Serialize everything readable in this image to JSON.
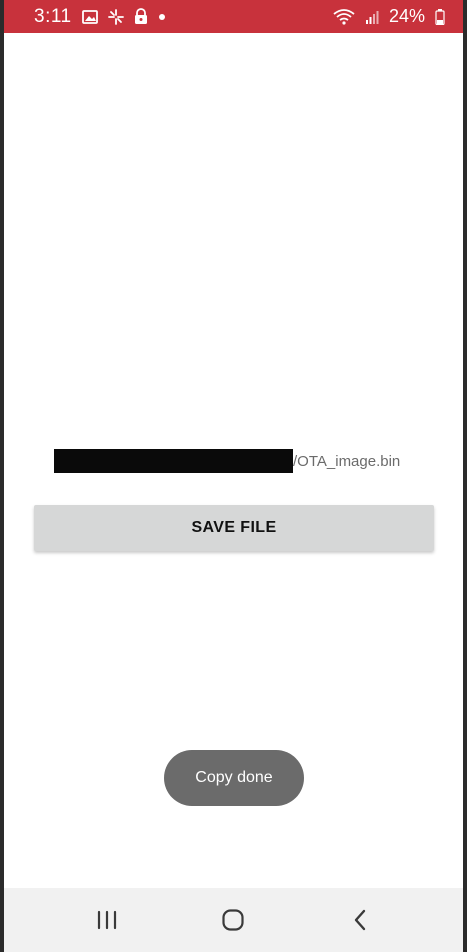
{
  "status_bar": {
    "time": "3:11",
    "battery": "24%",
    "background_color": "#c8323c",
    "icons_left": [
      "image-icon",
      "pinwheel-icon",
      "lock-icon",
      "notification-dot-icon"
    ],
    "icons_right": [
      "wifi-icon",
      "signal-icon",
      "battery-icon"
    ]
  },
  "main": {
    "file_path_suffix": "/OTA_image.bin",
    "save_button_label": "SAVE FILE",
    "toast_message": "Copy done"
  },
  "nav_bar": {
    "buttons": [
      "recent-apps-icon",
      "home-icon",
      "back-icon"
    ]
  }
}
